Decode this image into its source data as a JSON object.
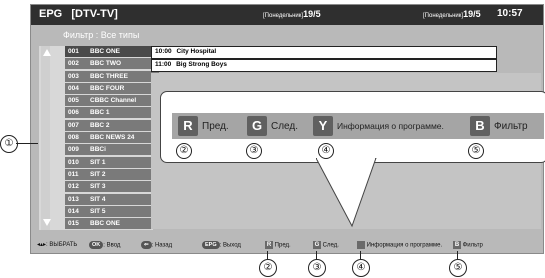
{
  "header": {
    "title": "EPG   [DTV-TV]",
    "date_day_left": "[Понедельник]",
    "date_left": "19/5",
    "date_day_right": "[Понедельник]",
    "date_right": "19/5",
    "time": "10:57"
  },
  "filter": {
    "label": "Фильтр",
    "separator": ":",
    "value": "Все типы"
  },
  "channels": [
    {
      "num": "001",
      "name": "BBC ONE"
    },
    {
      "num": "002",
      "name": "BBC TWO"
    },
    {
      "num": "003",
      "name": "BBC THREE"
    },
    {
      "num": "004",
      "name": "BBC FOUR"
    },
    {
      "num": "005",
      "name": "CBBC Channel"
    },
    {
      "num": "006",
      "name": "BBC 1"
    },
    {
      "num": "007",
      "name": "BBC 2"
    },
    {
      "num": "008",
      "name": "BBC NEWS 24"
    },
    {
      "num": "009",
      "name": "BBCi"
    },
    {
      "num": "010",
      "name": "SIT 1"
    },
    {
      "num": "011",
      "name": "SIT 2"
    },
    {
      "num": "012",
      "name": "SIT 3"
    },
    {
      "num": "013",
      "name": "SIT 4"
    },
    {
      "num": "014",
      "name": "SIT 5"
    },
    {
      "num": "015",
      "name": "BBC ONE"
    }
  ],
  "programs": [
    {
      "time": "10:00",
      "title": "City Hospital"
    },
    {
      "time": "11:00",
      "title": "Big Strong Boys"
    }
  ],
  "footer": {
    "select_label": ": ВЫБРАТЬ",
    "ok_key": "OK",
    "enter_label": ": Ввод",
    "back_key": "⇐",
    "back_label": ": Назад",
    "epg_key": "EPG",
    "exit_label": ": Выход",
    "r_key": "R",
    "prev_label": "Пред.",
    "g_key": "G",
    "next_label": "След.",
    "y_key": "Y",
    "info_label": "Информация о программе.",
    "b_key": "B",
    "filter_label": "Фильтр"
  },
  "callout": {
    "r_key": "R",
    "prev_label": "Пред.",
    "g_key": "G",
    "next_label": "След.",
    "y_key": "Y",
    "info_label": "Информация о программе.",
    "b_key": "B",
    "filter_label": "Фильтр"
  },
  "markers": {
    "m1": "①",
    "m2": "②",
    "m3": "③",
    "m4": "④",
    "m5": "⑤"
  }
}
